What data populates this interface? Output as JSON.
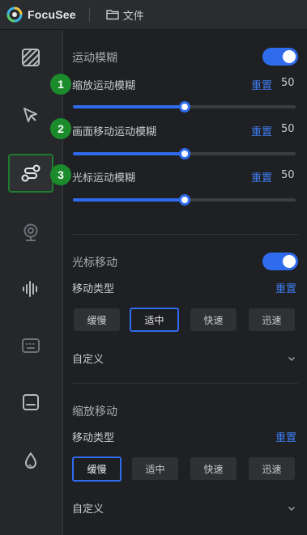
{
  "titlebar": {
    "brand": "FocuSee",
    "file_menu": "文件"
  },
  "sidebar": {
    "items": [
      {
        "icon": "background-pattern-icon",
        "active": false
      },
      {
        "icon": "cursor-icon",
        "active": false
      },
      {
        "icon": "motion-path-icon",
        "active": true
      },
      {
        "icon": "webcam-icon",
        "active": false
      },
      {
        "icon": "audio-waveform-icon",
        "active": false
      },
      {
        "icon": "keyboard-icon",
        "active": false
      },
      {
        "icon": "caption-icon",
        "active": false
      },
      {
        "icon": "color-drop-icon",
        "active": false
      }
    ]
  },
  "motion_blur": {
    "title": "运动模糊",
    "enabled": true,
    "rows": [
      {
        "badge": "1",
        "label": "缩放运动模糊",
        "reset": "重置",
        "value": "50",
        "level": 50
      },
      {
        "badge": "2",
        "label": "画面移动运动模糊",
        "reset": "重置",
        "value": "50",
        "level": 50
      },
      {
        "badge": "3",
        "label": "光标运动模糊",
        "reset": "重置",
        "value": "50",
        "level": 50
      }
    ]
  },
  "cursor_move": {
    "title": "光标移动",
    "enabled": true,
    "type_label": "移动类型",
    "reset": "重置",
    "options": [
      "缓慢",
      "适中",
      "快速",
      "迅速"
    ],
    "selected": "适中",
    "custom_label": "自定义"
  },
  "zoom_move": {
    "title": "缩放移动",
    "type_label": "移动类型",
    "reset": "重置",
    "options": [
      "缓慢",
      "适中",
      "快速",
      "迅速"
    ],
    "selected": "缓慢",
    "custom_label": "自定义"
  },
  "colors": {
    "accent": "#2f6bed",
    "link": "#3f7ef5",
    "badge": "#1c8b2c",
    "active_outline": "#1d7a2e"
  }
}
